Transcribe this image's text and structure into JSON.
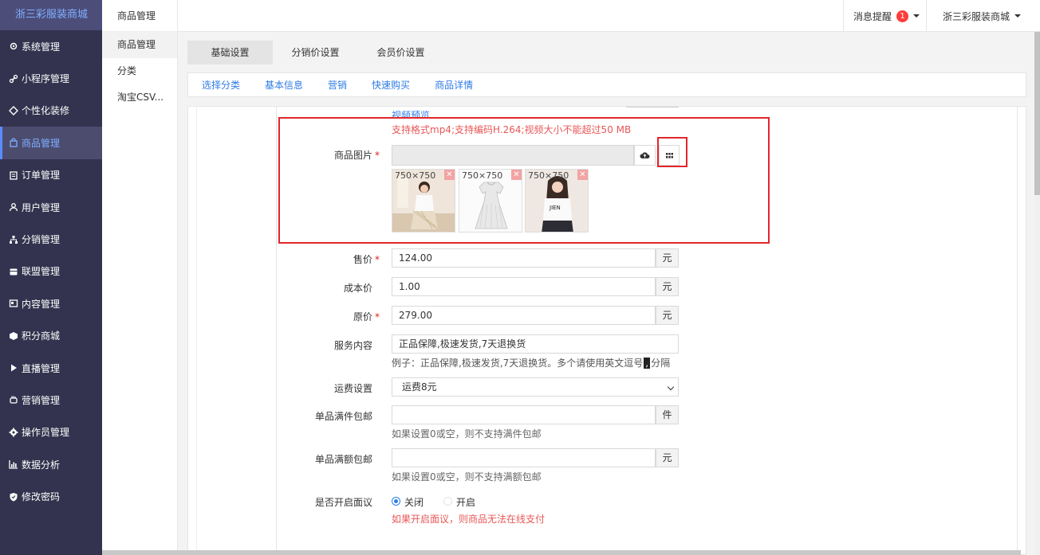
{
  "brand": "浙三彩服装商城",
  "sidebar": {
    "items": [
      {
        "label": "系统管理",
        "icon": "gear-icon"
      },
      {
        "label": "小程序管理",
        "icon": "link-icon"
      },
      {
        "label": "个性化装修",
        "icon": "diamond-icon"
      },
      {
        "label": "商品管理",
        "icon": "bag-icon"
      },
      {
        "label": "订单管理",
        "icon": "clipboard-icon"
      },
      {
        "label": "用户管理",
        "icon": "user-icon"
      },
      {
        "label": "分销管理",
        "icon": "sitemap-icon"
      },
      {
        "label": "联盟管理",
        "icon": "store-icon"
      },
      {
        "label": "内容管理",
        "icon": "document-icon"
      },
      {
        "label": "积分商城",
        "icon": "cube-icon"
      },
      {
        "label": "直播管理",
        "icon": "play-icon"
      },
      {
        "label": "营销管理",
        "icon": "hand-icon"
      },
      {
        "label": "操作员管理",
        "icon": "cog-icon"
      },
      {
        "label": "数据分析",
        "icon": "bar-chart-icon"
      },
      {
        "label": "修改密码",
        "icon": "shield-icon"
      }
    ],
    "active_index": 3
  },
  "submenu": {
    "title": "商品管理",
    "items": [
      "商品管理",
      "分类",
      "淘宝CSV..."
    ]
  },
  "topbar": {
    "messages_label": "消息提醒",
    "messages_count": "1",
    "shop_name": "浙三彩服装商城"
  },
  "tabs": [
    "基础设置",
    "分销价设置",
    "会员价设置"
  ],
  "subnav": [
    "选择分类",
    "基本信息",
    "营销",
    "快速购买",
    "商品详情"
  ],
  "form": {
    "video_preview": "视频预览",
    "video_hint": "支持格式mp4;支持编码H.264;视频大小不能超过50 MB",
    "image_label": "商品图片",
    "images": [
      {
        "size": "750×750",
        "alt": "dress-photo-1"
      },
      {
        "size": "750×750",
        "alt": "dress-photo-2"
      },
      {
        "size": "750×750",
        "alt": "dress-photo-3"
      }
    ],
    "price_label": "售价",
    "price_value": "124.00",
    "price_unit": "元",
    "cost_label": "成本价",
    "cost_value": "1.00",
    "cost_unit": "元",
    "original_label": "原价",
    "original_value": "279.00",
    "original_unit": "元",
    "service_label": "服务内容",
    "service_value": "正品保障,极速发货,7天退换货",
    "service_hint_a": "例子：正品保障,极速发货,7天退换货。多个请使用英文逗号",
    "service_hint_comma": ",",
    "service_hint_b": "分隔",
    "shipping_label": "运费设置",
    "shipping_value": "运费8元",
    "free_piece_label": "单品满件包邮",
    "free_piece_value": "",
    "free_piece_unit": "件",
    "free_piece_hint": "如果设置0或空，则不支持满件包邮",
    "free_amount_label": "单品满额包邮",
    "free_amount_value": "",
    "free_amount_unit": "元",
    "free_amount_hint": "如果设置0或空，则不支持满额包邮",
    "negotiate_label": "是否开启面议",
    "negotiate_off": "关闭",
    "negotiate_on": "开启",
    "negotiate_hint": "如果开启面议，则商品无法在线支付"
  },
  "colors": {
    "sidebar_bg": "#33334f",
    "accent": "#2f7ce6",
    "danger": "#e3262b"
  }
}
